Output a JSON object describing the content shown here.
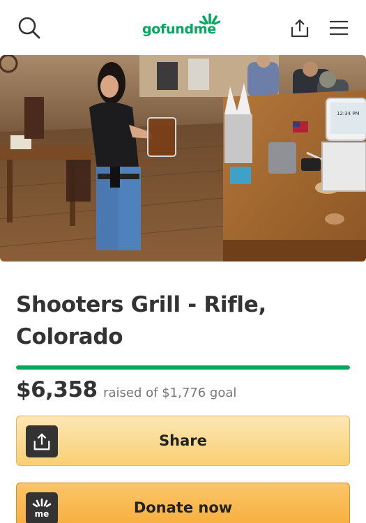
{
  "header": {
    "logo_text": "gofundme",
    "search_icon": "search-icon",
    "share_icon": "share-icon",
    "menu_icon": "hamburger-menu-icon",
    "brand_color": "#02a95c"
  },
  "campaign": {
    "title": "Shooters Grill - Rifle, Colorado",
    "raised": "$6,358",
    "raised_of": "raised of $1,776 goal",
    "progress_fraction": 1.0
  },
  "actions": {
    "share_label": "Share",
    "donate_label": "Donate now",
    "donate_icon_text": "me"
  },
  "hero": {
    "pos_screen_time": "12:34 PM"
  }
}
